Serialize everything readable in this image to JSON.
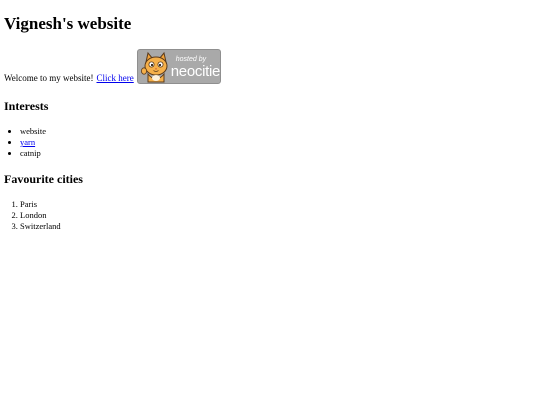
{
  "header": {
    "title": "Vignesh's website"
  },
  "welcome": {
    "text": "Welcome to my website!",
    "link_label": "Click here"
  },
  "badge": {
    "hosted_text": "hosted by",
    "brand_text": "neocities",
    "icon": "neocities-cat-icon",
    "background_color": "#a9a9a9"
  },
  "interests": {
    "heading": "Interests",
    "items": [
      {
        "label": "website",
        "is_link": false
      },
      {
        "label": "yarn",
        "is_link": true
      },
      {
        "label": "catnip",
        "is_link": false
      }
    ]
  },
  "cities": {
    "heading": "Favourite cities",
    "items": [
      "Paris",
      "London",
      "Switzerland"
    ]
  },
  "colors": {
    "link": "#0000ee",
    "text": "#000000",
    "background": "#ffffff"
  }
}
